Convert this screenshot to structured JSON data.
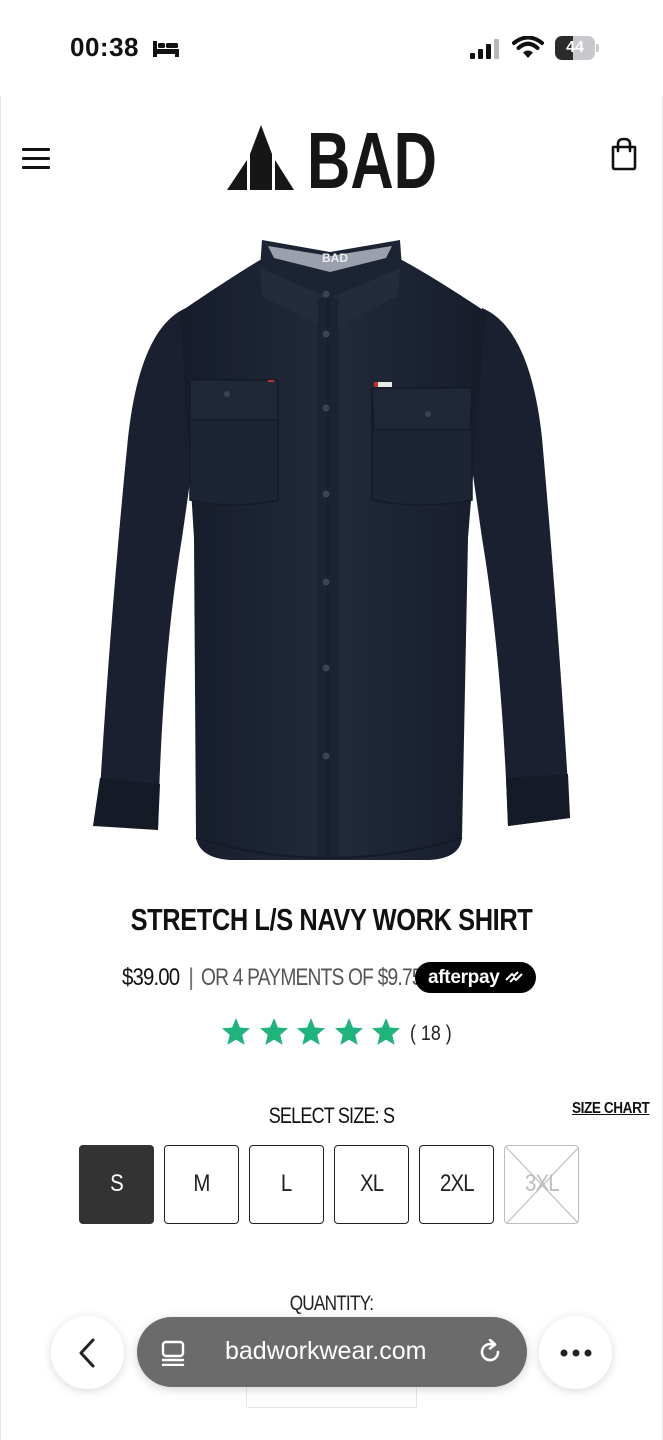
{
  "status_bar": {
    "time": "00:38",
    "battery_level": "44",
    "battery_percent": 44,
    "icons": [
      "sleep-bed-icon",
      "signal-icon",
      "wifi-icon",
      "battery-icon"
    ]
  },
  "header": {
    "menu_icon": "hamburger-icon",
    "logo_text": "BAD",
    "cart_icon": "shopping-bag-icon"
  },
  "product": {
    "image_alt": "navy long-sleeve work shirt",
    "title": "STRETCH L/S NAVY WORK SHIRT",
    "price": "$39.00",
    "separator": "|",
    "installments": "OR 4 PAYMENTS OF $9.75",
    "afterpay_label": "afterpay",
    "rating_stars": 5,
    "review_count": "( 18 )",
    "select_size_label": "SELECT SIZE: S",
    "size_chart_label": "SIZE CHART",
    "sizes": [
      {
        "label": "S",
        "selected": true,
        "available": true
      },
      {
        "label": "M",
        "selected": false,
        "available": true
      },
      {
        "label": "L",
        "selected": false,
        "available": true
      },
      {
        "label": "XL",
        "selected": false,
        "available": true
      },
      {
        "label": "2XL",
        "selected": false,
        "available": true
      },
      {
        "label": "3XL",
        "selected": false,
        "available": false
      }
    ],
    "quantity_label": "QUANTITY:"
  },
  "browser": {
    "url": "badworkwear.com",
    "back_icon": "chevron-left-icon",
    "reader_icon": "reader-mode-icon",
    "reload_icon": "reload-icon",
    "more_icon": "more-dots-icon"
  },
  "colors": {
    "star": "#1fb47c",
    "selected_size_bg": "#333333",
    "shirt": "#1e2535",
    "afterpay_bg": "#000000",
    "url_pill": "#6b6b6b"
  }
}
